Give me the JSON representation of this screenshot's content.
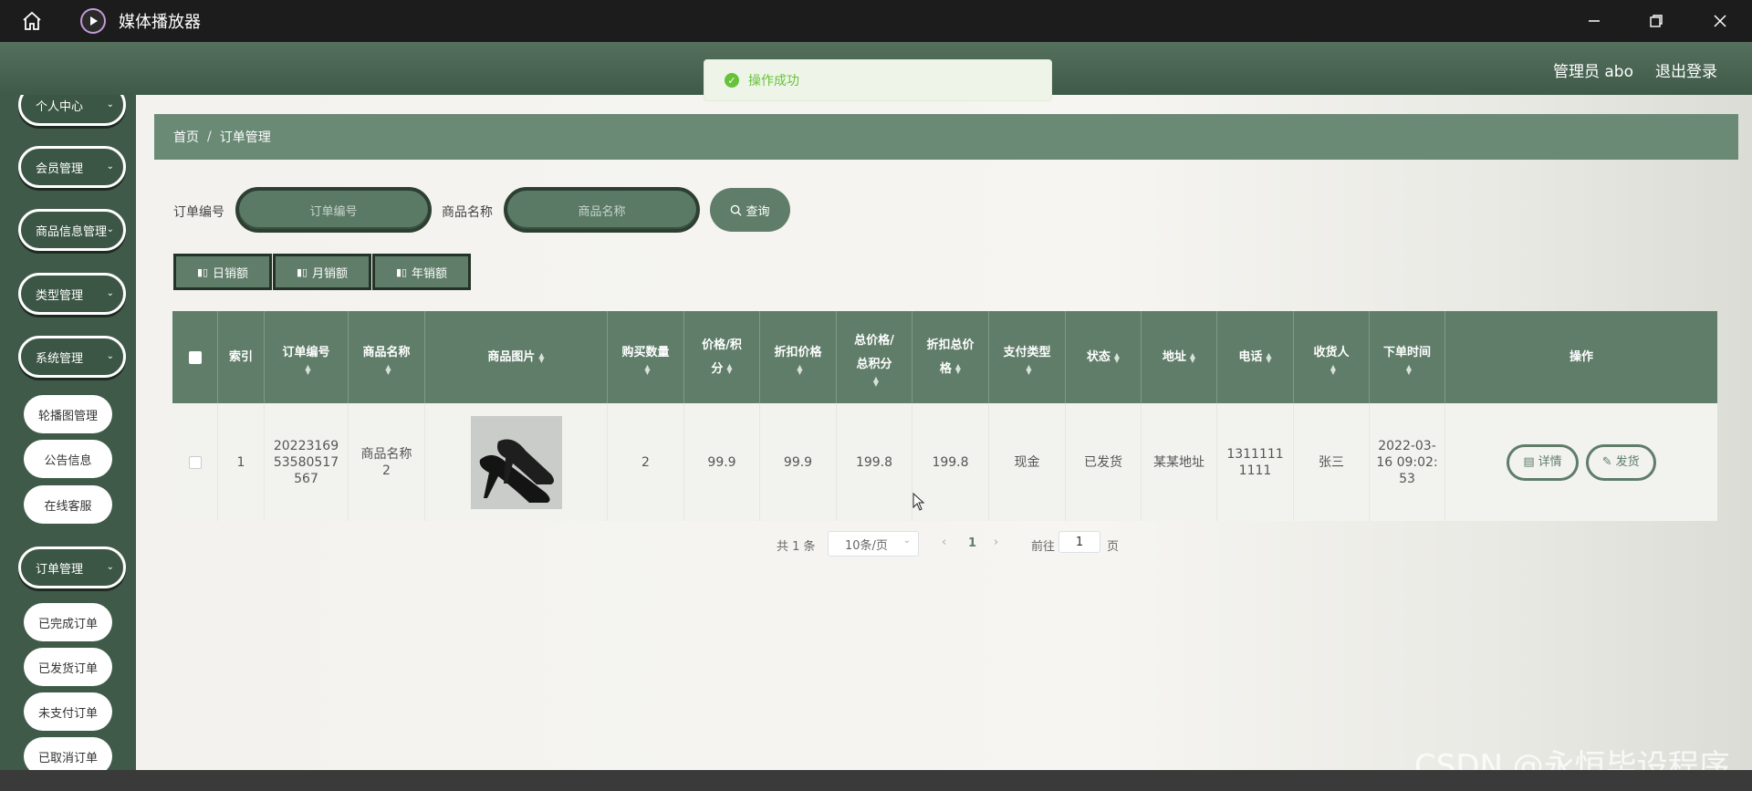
{
  "window": {
    "title": "媒体播放器"
  },
  "header": {
    "admin_label": "管理员 abo",
    "logout_label": "退出登录"
  },
  "toast": {
    "message": "操作成功"
  },
  "sidebar": {
    "items": [
      {
        "label": "个人中心"
      },
      {
        "label": "会员管理"
      },
      {
        "label": "商品信息管理"
      },
      {
        "label": "类型管理"
      },
      {
        "label": "系统管理"
      },
      {
        "label": "订单管理"
      }
    ],
    "system_sub": [
      {
        "label": "轮播图管理"
      },
      {
        "label": "公告信息"
      },
      {
        "label": "在线客服"
      }
    ],
    "order_sub": [
      {
        "label": "已完成订单"
      },
      {
        "label": "已发货订单"
      },
      {
        "label": "未支付订单"
      },
      {
        "label": "已取消订单"
      }
    ]
  },
  "breadcrumb": {
    "home": "首页",
    "sep": "/",
    "current": "订单管理"
  },
  "search": {
    "order_no_label": "订单编号",
    "order_no_placeholder": "订单编号",
    "product_label": "商品名称",
    "product_placeholder": "商品名称",
    "query_label": "查询"
  },
  "stats": {
    "daily": "日销额",
    "monthly": "月销额",
    "yearly": "年销额"
  },
  "table": {
    "headers": {
      "index": "索引",
      "order_no": "订单编号",
      "product_name": "商品名称",
      "product_image": "商品图片",
      "quantity": "购买数量",
      "price_1": "价格/积",
      "price_2": "分",
      "discount_price": "折扣价格",
      "total_1": "总价格/",
      "total_2": "总积分",
      "discount_total_1": "折扣总价",
      "discount_total_2": "格",
      "pay_type": "支付类型",
      "status": "状态",
      "address": "地址",
      "phone": "电话",
      "receiver": "收货人",
      "order_time": "下单时间",
      "actions": "操作"
    },
    "row": {
      "index": "1",
      "order_no_1": "20223169",
      "order_no_2": "53580517",
      "order_no_3": "567",
      "product_name_1": "商品名称",
      "product_name_2": "2",
      "quantity": "2",
      "price": "99.9",
      "discount_price": "99.9",
      "total": "199.8",
      "discount_total": "199.8",
      "pay_type": "现金",
      "status": "已发货",
      "address": "某某地址",
      "phone_1": "1311111",
      "phone_2": "1111",
      "receiver": "张三",
      "time_1": "2022-03-",
      "time_2": "16 09:02:",
      "time_3": "53",
      "detail_label": "详情",
      "ship_label": "发货"
    }
  },
  "pagination": {
    "total": "共 1 条",
    "page_size": "10条/页",
    "current_page": "1",
    "goto_label": "前往",
    "goto_value": "1",
    "page_suffix": "页"
  },
  "watermark": "CSDN @永恒毕设程序",
  "colors": {
    "primary": "#5f7d69",
    "sidebar": "#3f5a48",
    "success": "#67c23a"
  }
}
